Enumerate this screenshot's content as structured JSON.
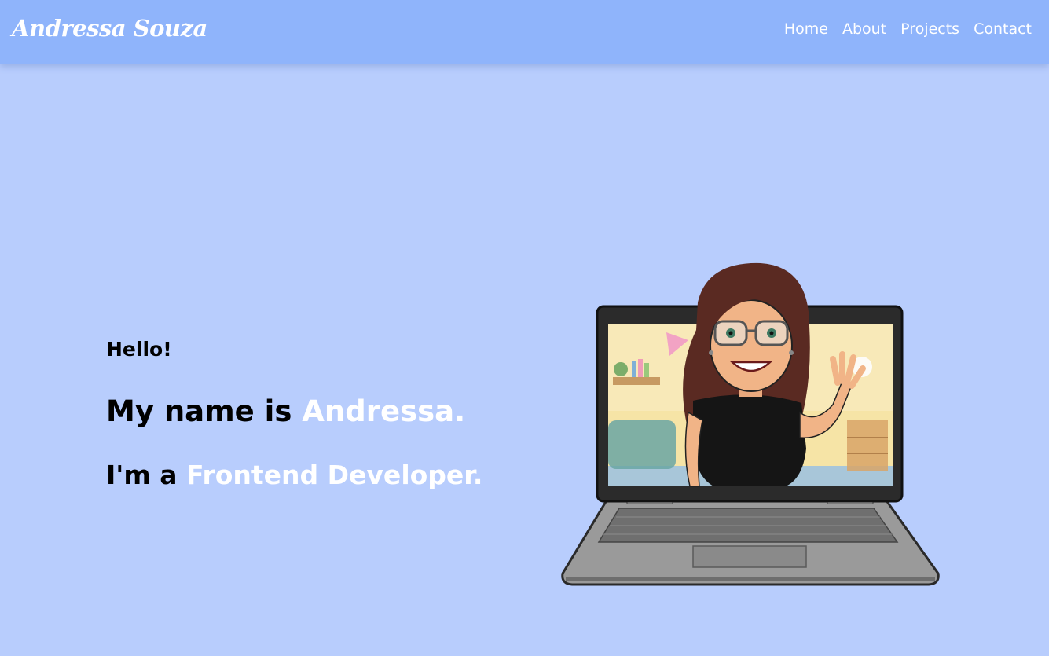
{
  "header": {
    "brand": "Andressa Souza",
    "nav": [
      {
        "label": "Home"
      },
      {
        "label": "About"
      },
      {
        "label": "Projects"
      },
      {
        "label": "Contact"
      }
    ]
  },
  "hero": {
    "greeting": "Hello!",
    "name_prefix": "My name is ",
    "name": "Andressa.",
    "role_prefix": "I'm a ",
    "role": "Frontend Developer.",
    "illustration": "avatar-on-laptop-illustration"
  },
  "colors": {
    "navbar": "#8fb4fb",
    "background": "#b8cdfd",
    "accent_text": "#ffffff"
  }
}
